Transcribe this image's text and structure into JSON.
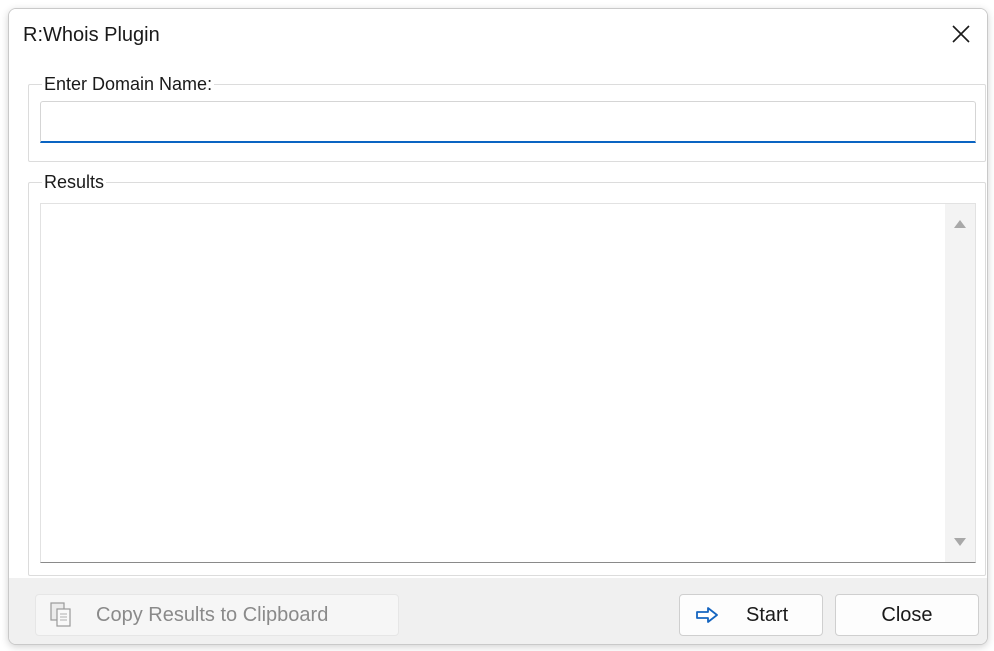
{
  "window": {
    "title": "R:Whois Plugin"
  },
  "domain_group": {
    "label": "Enter Domain Name:",
    "input_value": "",
    "input_placeholder": ""
  },
  "results_group": {
    "label": "Results",
    "content": ""
  },
  "footer": {
    "copy_label": "Copy Results to Clipboard",
    "copy_icon": "clipboard-copy-icon",
    "start_label": "Start",
    "start_icon": "arrow-right-icon",
    "close_label": "Close"
  },
  "colors": {
    "accent": "#0a64c2",
    "start_arrow": "#1565c0"
  }
}
